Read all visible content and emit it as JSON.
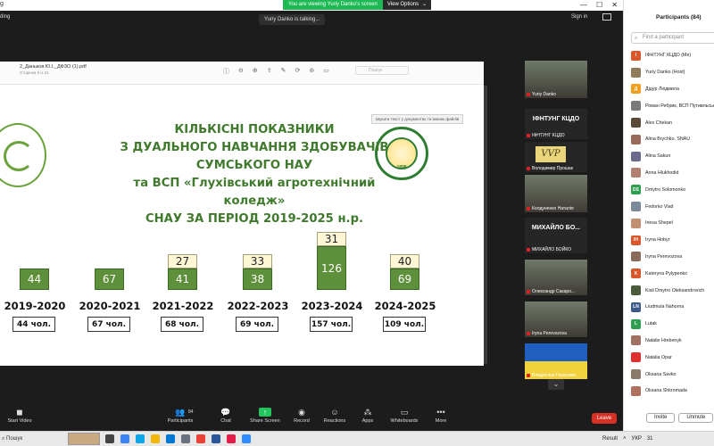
{
  "window": {
    "app_label": "g",
    "recording_label": "ding",
    "share_banner": "You are viewing Yuriy Danko's screen",
    "view_options": "View Options",
    "talking": "Yuriy Danko is talking...",
    "sign_in": "Sign in"
  },
  "pdf": {
    "file_name": "2_Даньков Ю.І._ДФЗО (1).pdf",
    "page_info": "Сторінка 6 із 24",
    "search_placeholder": "Пошук",
    "tooltip": "Шукати текст у документах та іменах файлів"
  },
  "slide": {
    "title_lines": [
      "КІЛЬКІСНІ ПОКАЗНИКИ",
      "З ДУАЛЬНОГО НАВЧАННЯ ЗДОБУВАЧІВ",
      "СУМСЬКОГО НАУ",
      "та ВСП «Глухівський агротехнічний коледж»",
      "СНАУ ЗА ПЕРІОД 2019-2025 н.р."
    ],
    "logo_right_year": "1898"
  },
  "chart_data": {
    "type": "bar",
    "stacked": true,
    "categories": [
      "2019-2020",
      "2020-2021",
      "2021-2022",
      "2022-2023",
      "2023-2024",
      "2024-2025"
    ],
    "series": [
      {
        "color": "#5e8f3a",
        "values": [
          44,
          67,
          41,
          38,
          126,
          69
        ]
      },
      {
        "color": "#fff6d5",
        "values": [
          null,
          null,
          27,
          33,
          31,
          40
        ]
      }
    ],
    "totals": [
      "44 чол.",
      "67 чол.",
      "68 чол.",
      "69 чол.",
      "157 чол.",
      "109 чол."
    ]
  },
  "videos": [
    {
      "name": "Yuriy Danko",
      "type": "camera"
    },
    {
      "name": "ІФНТУНГ КЦДО",
      "big": "ІФНТУНГ КЦДО",
      "type": "text"
    },
    {
      "name": "Володимир Прошак",
      "type": "vvp",
      "vvp": "VVP"
    },
    {
      "name": "Колдуненко Наталія",
      "type": "camera"
    },
    {
      "name": "МИХАЙЛО БОЙКО",
      "big": "МИХАЙЛО БО...",
      "type": "text"
    },
    {
      "name": "Олександр Сакаро...",
      "type": "camera"
    },
    {
      "name": "Iryna Perevozova",
      "type": "camera"
    },
    {
      "name": "Владислав Герасиме...",
      "type": "flag"
    }
  ],
  "toolbar": {
    "start_video": "Start Video",
    "participants": "Participants",
    "participants_count": "84",
    "chat": "Chat",
    "share_screen": "Share Screen",
    "record": "Record",
    "reactions": "Reactions",
    "apps": "Apps",
    "whiteboards": "Whiteboards",
    "more": "More",
    "leave": "Leave"
  },
  "participants": {
    "title": "Participants (84)",
    "search_placeholder": "Find a participant",
    "invite": "Invite",
    "unmute": "Unmute",
    "list": [
      {
        "name": "ІФНТУНГ КЦДО (Me)",
        "initial": "І",
        "color": "#d9572b"
      },
      {
        "name": "Yuriy Danko (Host)",
        "initial": "",
        "color": "#8f7a5a"
      },
      {
        "name": "Дідур Людмила",
        "initial": "Д",
        "color": "#f0a020"
      },
      {
        "name": "Роман Ребрик, ВСП Путивльський коледж",
        "initial": "",
        "color": "#7a7a7a"
      },
      {
        "name": "Alex Chekan",
        "initial": "",
        "color": "#5a4a3a"
      },
      {
        "name": "Alina Brychko, SNAU",
        "initial": "",
        "color": "#9a6a5a"
      },
      {
        "name": "Alina Sakun",
        "initial": "",
        "color": "#6a6a8a"
      },
      {
        "name": "Anna Hlukhodid",
        "initial": "",
        "color": "#b08070"
      },
      {
        "name": "Dmytro Solomonko",
        "initial": "DS",
        "color": "#2e9e4f"
      },
      {
        "name": "Fedorko Vlad",
        "initial": "",
        "color": "#7a8a9a"
      },
      {
        "name": "Inesa Shepel",
        "initial": "",
        "color": "#c09070"
      },
      {
        "name": "Iryna Hobyr",
        "initial": "IH",
        "color": "#d9572b"
      },
      {
        "name": "Iryna Perevozova",
        "initial": "",
        "color": "#8a6a5a"
      },
      {
        "name": "Kateryna Pylypenko",
        "initial": "K",
        "color": "#d9572b"
      },
      {
        "name": "Kisil Dmytro Oleksandrovich",
        "initial": "",
        "color": "#4a5a3a"
      },
      {
        "name": "Liudmula Nahorna",
        "initial": "LN",
        "color": "#3b5a8a"
      },
      {
        "name": "Lutak",
        "initial": "L",
        "color": "#2e9e4f"
      },
      {
        "name": "Natalie Hrebenyk",
        "initial": "",
        "color": "#a07060"
      },
      {
        "name": "Natalia Opar",
        "initial": "",
        "color": "#e03030"
      },
      {
        "name": "Oksana Savko",
        "initial": "",
        "color": "#8a7a6a"
      },
      {
        "name": "Oksana Shkromada",
        "initial": "",
        "color": "#b07060"
      }
    ]
  },
  "taskbar": {
    "search": "Пошук",
    "result": "Result",
    "lang": "УКР",
    "clock": "31"
  }
}
